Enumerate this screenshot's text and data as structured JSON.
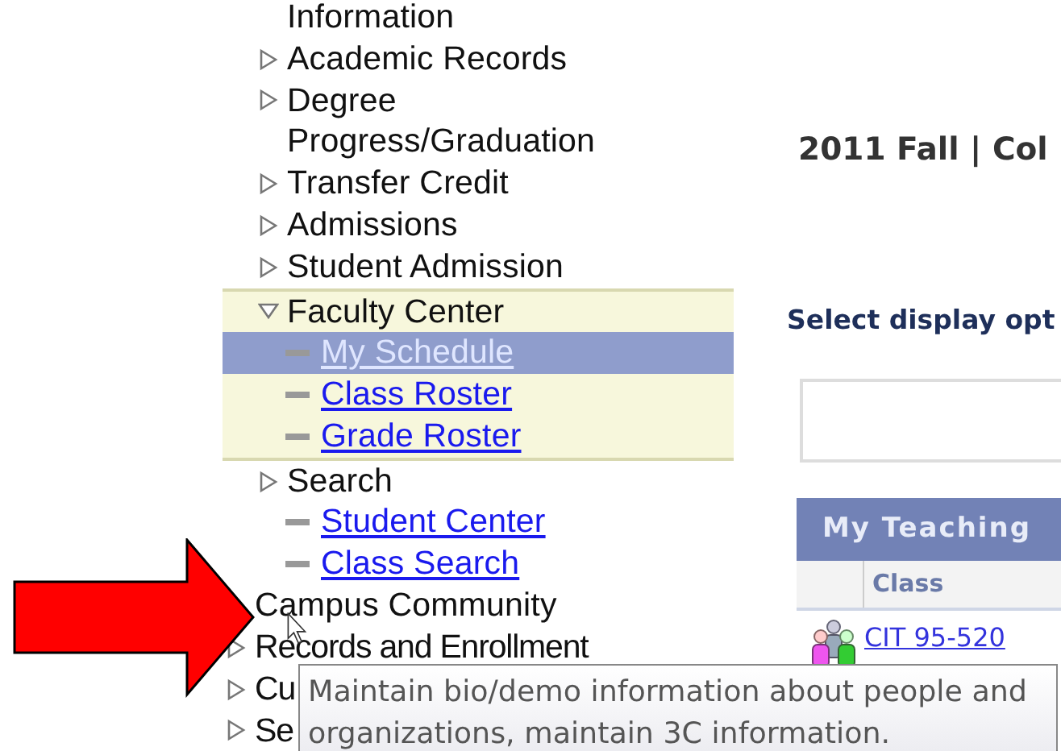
{
  "nav": {
    "items": [
      {
        "label": "Information",
        "kind": "continuation"
      },
      {
        "label": "Academic Records",
        "kind": "folder"
      },
      {
        "label": "Degree\nProgress/Graduation",
        "kind": "folder"
      },
      {
        "label": "Transfer Credit",
        "kind": "folder"
      },
      {
        "label": "Admissions",
        "kind": "folder"
      },
      {
        "label": "Student Admission",
        "kind": "folder"
      },
      {
        "label": "Faculty Center",
        "kind": "folder",
        "expanded": true,
        "children": [
          {
            "label": "My Schedule",
            "kind": "link",
            "selected": true
          },
          {
            "label": "Class Roster",
            "kind": "link",
            "selected": false
          },
          {
            "label": "Grade Roster",
            "kind": "link",
            "selected": false
          }
        ]
      },
      {
        "label": "Search",
        "kind": "folder"
      },
      {
        "label": "Student Center",
        "kind": "link",
        "selected": false
      },
      {
        "label": "Class Search",
        "kind": "link",
        "selected": false
      },
      {
        "label": "Campus Community",
        "kind": "top-plain"
      },
      {
        "label": "Records and Enrollment",
        "kind": "top-folder"
      },
      {
        "label": "Cu",
        "kind": "top-folder"
      },
      {
        "label": "Se",
        "kind": "top-folder"
      }
    ]
  },
  "content": {
    "term": "2011 Fall | Col",
    "display_prompt": "Select display opt",
    "table": {
      "title": "My Teaching",
      "columns": [
        "Class"
      ],
      "rows": [
        {
          "class": "CIT 95-520"
        }
      ]
    }
  },
  "tooltip": "Maintain bio/demo information about people and organizations, maintain 3C information."
}
